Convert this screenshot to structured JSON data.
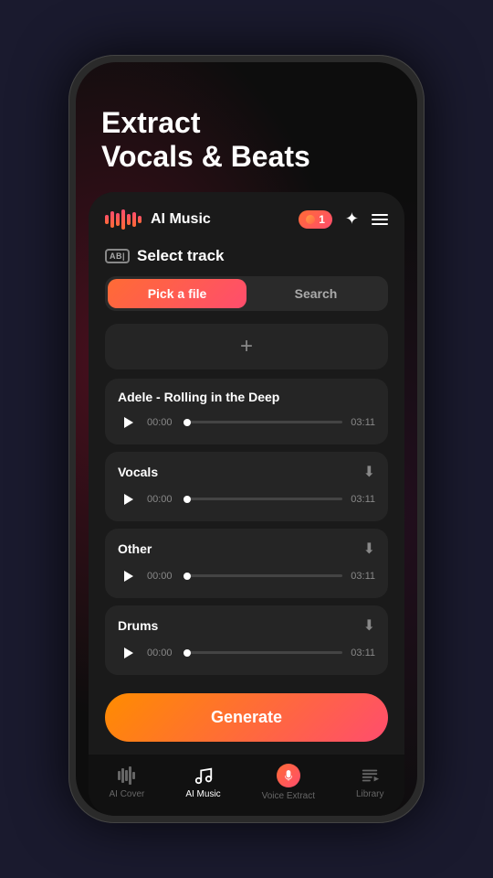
{
  "hero": {
    "title": "Extract\nVocals & Beats"
  },
  "appHeader": {
    "title": "AI Music",
    "notificationCount": "1",
    "waveformBars": [
      14,
      22,
      18,
      26,
      16,
      20,
      12
    ]
  },
  "selectTrack": {
    "label": "Select track",
    "abBadge": "AB|"
  },
  "tabs": {
    "pickFile": "Pick a file",
    "search": "Search"
  },
  "uploadArea": {
    "icon": "+"
  },
  "tracks": [
    {
      "name": "Adele - Rolling in the Deep",
      "timeStart": "00:00",
      "timeEnd": "03:11",
      "hasDownload": false
    },
    {
      "name": "Vocals",
      "timeStart": "00:00",
      "timeEnd": "03:11",
      "hasDownload": true
    },
    {
      "name": "Other",
      "timeStart": "00:00",
      "timeEnd": "03:11",
      "hasDownload": true
    },
    {
      "name": "Drums",
      "timeStart": "00:00",
      "timeEnd": "03:11",
      "hasDownload": true
    }
  ],
  "generateButton": {
    "label": "Generate"
  },
  "bottomNav": [
    {
      "label": "AI Cover",
      "icon": "waveform",
      "active": false
    },
    {
      "label": "AI Music",
      "icon": "music",
      "active": true
    },
    {
      "label": "Voice Extract",
      "icon": "voice",
      "active": false
    },
    {
      "label": "Library",
      "icon": "library",
      "active": false
    }
  ]
}
